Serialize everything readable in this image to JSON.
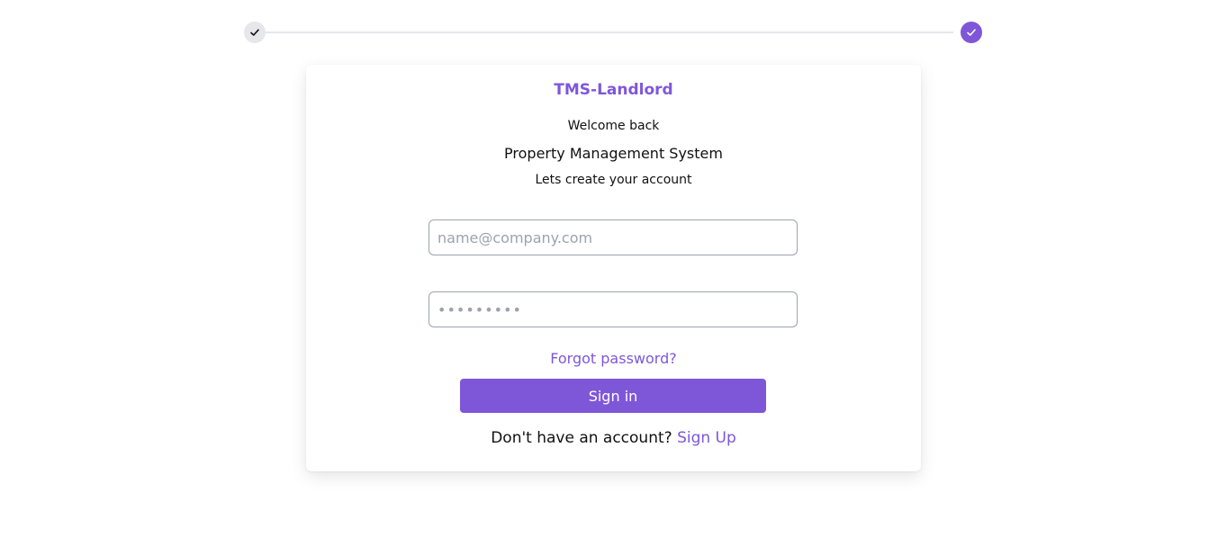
{
  "stepper": {
    "steps": [
      {
        "status": "complete",
        "icon": "check-icon",
        "color": "#e5e7eb"
      },
      {
        "status": "complete",
        "icon": "check-icon",
        "color": "#7e57d9"
      }
    ]
  },
  "card": {
    "brand": "TMS-Landlord",
    "welcome": "Welcome back",
    "system": "Property Management System",
    "subtitle": "Lets create your account"
  },
  "form": {
    "email": {
      "placeholder": "name@company.com",
      "value": ""
    },
    "password": {
      "placeholder": "•••••••••",
      "value": ""
    },
    "forgot_label": "Forgot password?",
    "signin_label": "Sign in"
  },
  "footer": {
    "prompt": "Don't have an account?",
    "signup_label": "Sign Up"
  },
  "colors": {
    "accent": "#7e57d9",
    "text": "#111111",
    "muted": "#9ca3af",
    "step_inactive": "#e5e7eb"
  }
}
